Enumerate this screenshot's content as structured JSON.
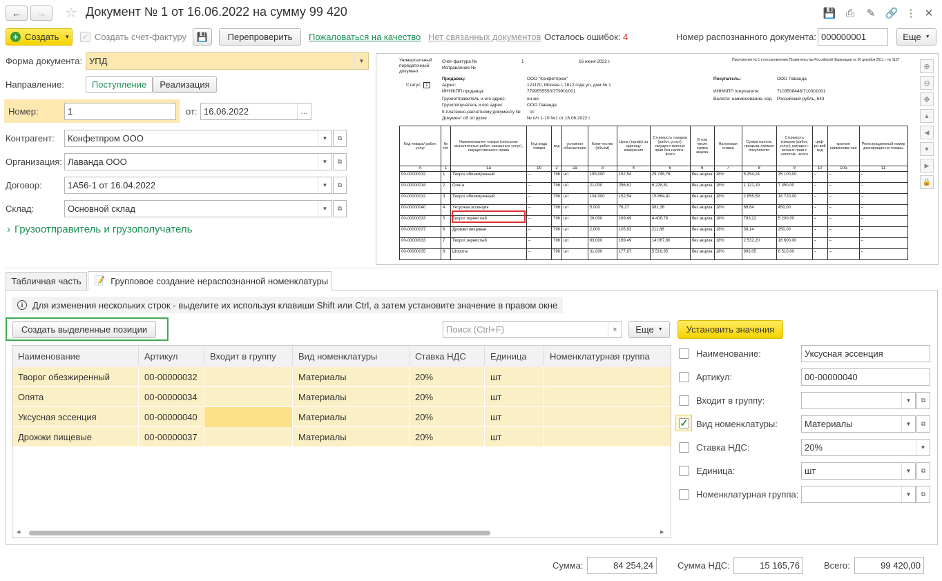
{
  "window": {
    "title": "Документ № 1 от 16.06.2022 на сумму 99 420"
  },
  "toolbar": {
    "create_label": "Создать",
    "create_invoice_label": "Создать счет-фактуру",
    "recheck_label": "Перепроверить",
    "complain_label": "Пожаловаться на качество",
    "no_docs_label": "Нет связанных документов",
    "errors_label": "Осталось ошибок:",
    "errors_count": "4",
    "recognized_label": "Номер распознанного документа:",
    "recognized_value": "000000001",
    "more_label": "Еще"
  },
  "form": {
    "doc_form_label": "Форма документа:",
    "doc_form_value": "УПД",
    "direction_label": "Направление:",
    "direction_in": "Поступление",
    "direction_out": "Реализация",
    "number_label": "Номер:",
    "number_value": "1",
    "date_label": "от:",
    "date_value": "16.06.2022",
    "counterparty_label": "Контрагент:",
    "counterparty_value": "Конфетпром ООО",
    "org_label": "Организация:",
    "org_value": "Лаванда ООО",
    "contract_label": "Договор:",
    "contract_value": "1А56-1 от 16.04.2022",
    "warehouse_label": "Склад:",
    "warehouse_value": "Основной склад",
    "shipper_link": "Грузоотправитель и грузополучатель"
  },
  "scan": {
    "header_left": "Универсальный передаточный документ",
    "invoice_label": "Счет-фактура №",
    "invoice_no": "1",
    "invoice_date": "16 июня 2022 г.",
    "fix_label": "Исправление №",
    "status_label": "Статус:",
    "status_value": "1",
    "seller_label": "Продавец:",
    "seller_value": "ООО \"Конфетпром\"",
    "address_label": "Адрес:",
    "address_value": "121170, Москва г, 1812 года ул, дом № 1",
    "inn_label": "ИНН/КПП продавца:",
    "inn_value": "7799555550/779901001",
    "shipper_label": "Грузоотправитель и его адрес:",
    "shipper_value": "он же",
    "consignee_label": "Грузополучатель и его адрес:",
    "consignee_value": "ООО Лаванда",
    "payment_label": "К платежно-расчетному документу №",
    "payment_value": "от",
    "shipdoc_label": "Документ об отгрузке",
    "shipdoc_value": "№ п/п 1-10 №1 от 16.06.2022 г.",
    "buyer_label": "Покупатель:",
    "buyer_value": "ООО Лаванда",
    "buyer_inn_label": "ИНН/КПП покупателя:",
    "buyer_inn_value": "7103508448/710301001",
    "currency_label": "Валюта: наименование, код",
    "currency_value": "Российский рубль, 643",
    "note_right": "Приложение № 1 к постановлению Правительства Российской Федерации от 26 декабря 2011 г. № 1137",
    "columns": [
      "Код товара/ работ, услуг",
      "№ п/п",
      "Наименование товара (описание выполненных работ, оказанных услуг), имущественного права",
      "Код вида товара",
      "код",
      "условное обозначение",
      "Коли-чество (объем)",
      "Цена (тариф) за единицу измерения",
      "Стоимость товаров (работ, услуг), имущест-венных прав без налога - всего",
      "В том числе сумма акциза",
      "Налоговая ставка",
      "Сумма налога, предъяв-ляемая покупателю",
      "Стоимость товаров (работ, услуг), имущест-венных прав с налогом - всего",
      "циф-ро-вой код",
      "краткое наименова-ние",
      "Регистрационный номер декларации на товары"
    ],
    "col_letters": [
      "А",
      "1",
      "1а",
      "1б",
      "2",
      "2а",
      "3",
      "4",
      "5",
      "6",
      "7",
      "8",
      "9",
      "10",
      "10а",
      "11"
    ],
    "rows": [
      [
        "00-00000032",
        "1",
        "Творог обезжиренный",
        "–",
        "796",
        "шт",
        "195,000",
        "152,54",
        "29 745,76",
        "без акциза",
        "18%",
        "5 354,24",
        "35 100,00",
        "–",
        "–",
        "–"
      ],
      [
        "00-00000034",
        "2",
        "Опята",
        "–",
        "796",
        "шт",
        "21,000",
        "296,61",
        "6 228,81",
        "без акциза",
        "18%",
        "1 121,19",
        "7 350,00",
        "–",
        "–",
        "–"
      ],
      [
        "00-00000032",
        "3",
        "Творог обезжиренный",
        "–",
        "796",
        "шт",
        "104,000",
        "152,54",
        "15 864,41",
        "без акциза",
        "18%",
        "2 855,59",
        "18 720,00",
        "–",
        "–",
        "–"
      ],
      [
        "00-00000040",
        "4",
        "Уксусная эссенция",
        "–",
        "796",
        "шт",
        "5,000",
        "76,27",
        "381,36",
        "без акциза",
        "18%",
        "68,64",
        "450,00",
        "–",
        "–",
        "–"
      ],
      [
        "00-00000033",
        "5",
        "Творог зернистый",
        "–",
        "796",
        "шт",
        "26,000",
        "169,49",
        "4 406,78",
        "без акциза",
        "18%",
        "793,22",
        "5 200,00",
        "–",
        "–",
        "–"
      ],
      [
        "00-00000037",
        "6",
        "Дрожжи пищевые",
        "–",
        "796",
        "шт",
        "2,000",
        "105,93",
        "211,86",
        "без акциза",
        "18%",
        "38,14",
        "250,00",
        "–",
        "–",
        "–"
      ],
      [
        "00-00000033",
        "7",
        "Творог зернистый",
        "–",
        "796",
        "шт",
        "83,000",
        "169,49",
        "14 067,80",
        "без акциза",
        "18%",
        "2 532,20",
        "16 600,00",
        "–",
        "–",
        "–"
      ],
      [
        "00-00000035",
        "8",
        "Шпроты",
        "–",
        "796",
        "шт",
        "31,000",
        "177,97",
        "5 516,95",
        "без акциза",
        "18%",
        "993,05",
        "6 510,00",
        "–",
        "–",
        "–"
      ]
    ]
  },
  "tabs": {
    "tab1": "Табличная часть",
    "tab2": "Групповое создание нераспознанной номенклатуры"
  },
  "info_text": "Для изменения нескольких строк - выделите их используя клавиши Shift или Ctrl, а затем установите значение в правом окне",
  "group": {
    "create_selected_label": "Создать выделенные позиции",
    "search_placeholder": "Поиск (Ctrl+F)",
    "more_label": "Еще",
    "set_values_label": "Установить значения",
    "columns": [
      "Наименование",
      "Артикул",
      "Входит в группу",
      "Вид номенклатуры",
      "Ставка НДС",
      "Единица",
      "Номенклатурная группа"
    ],
    "rows": [
      [
        "Творог обезжиренный",
        "00-00000032",
        "",
        "Материалы",
        "20%",
        "шт",
        ""
      ],
      [
        "Опята",
        "00-00000034",
        "",
        "Материалы",
        "20%",
        "шт",
        ""
      ],
      [
        "Уксусная эссенция",
        "00-00000040",
        "",
        "Материалы",
        "20%",
        "шт",
        ""
      ],
      [
        "Дрожжи пищевые",
        "00-00000037",
        "",
        "Материалы",
        "20%",
        "шт",
        ""
      ]
    ]
  },
  "panel": {
    "name_label": "Наименование:",
    "name_value": "Уксусная эссенция",
    "article_label": "Артикул:",
    "article_value": "00-00000040",
    "group_label": "Входит в группу:",
    "group_value": "",
    "kind_label": "Вид номенклатуры:",
    "kind_value": "Материалы",
    "vat_label": "Ставка НДС:",
    "vat_value": "20%",
    "unit_label": "Единица:",
    "unit_value": "шт",
    "nomgroup_label": "Номенклатурная группа:",
    "nomgroup_value": ""
  },
  "totals": {
    "sum_label": "Сумма:",
    "sum_value": "84 254,24",
    "vat_label": "Сумма НДС:",
    "vat_value": "15 165,76",
    "total_label": "Всего:",
    "total_value": "99 420,00"
  }
}
